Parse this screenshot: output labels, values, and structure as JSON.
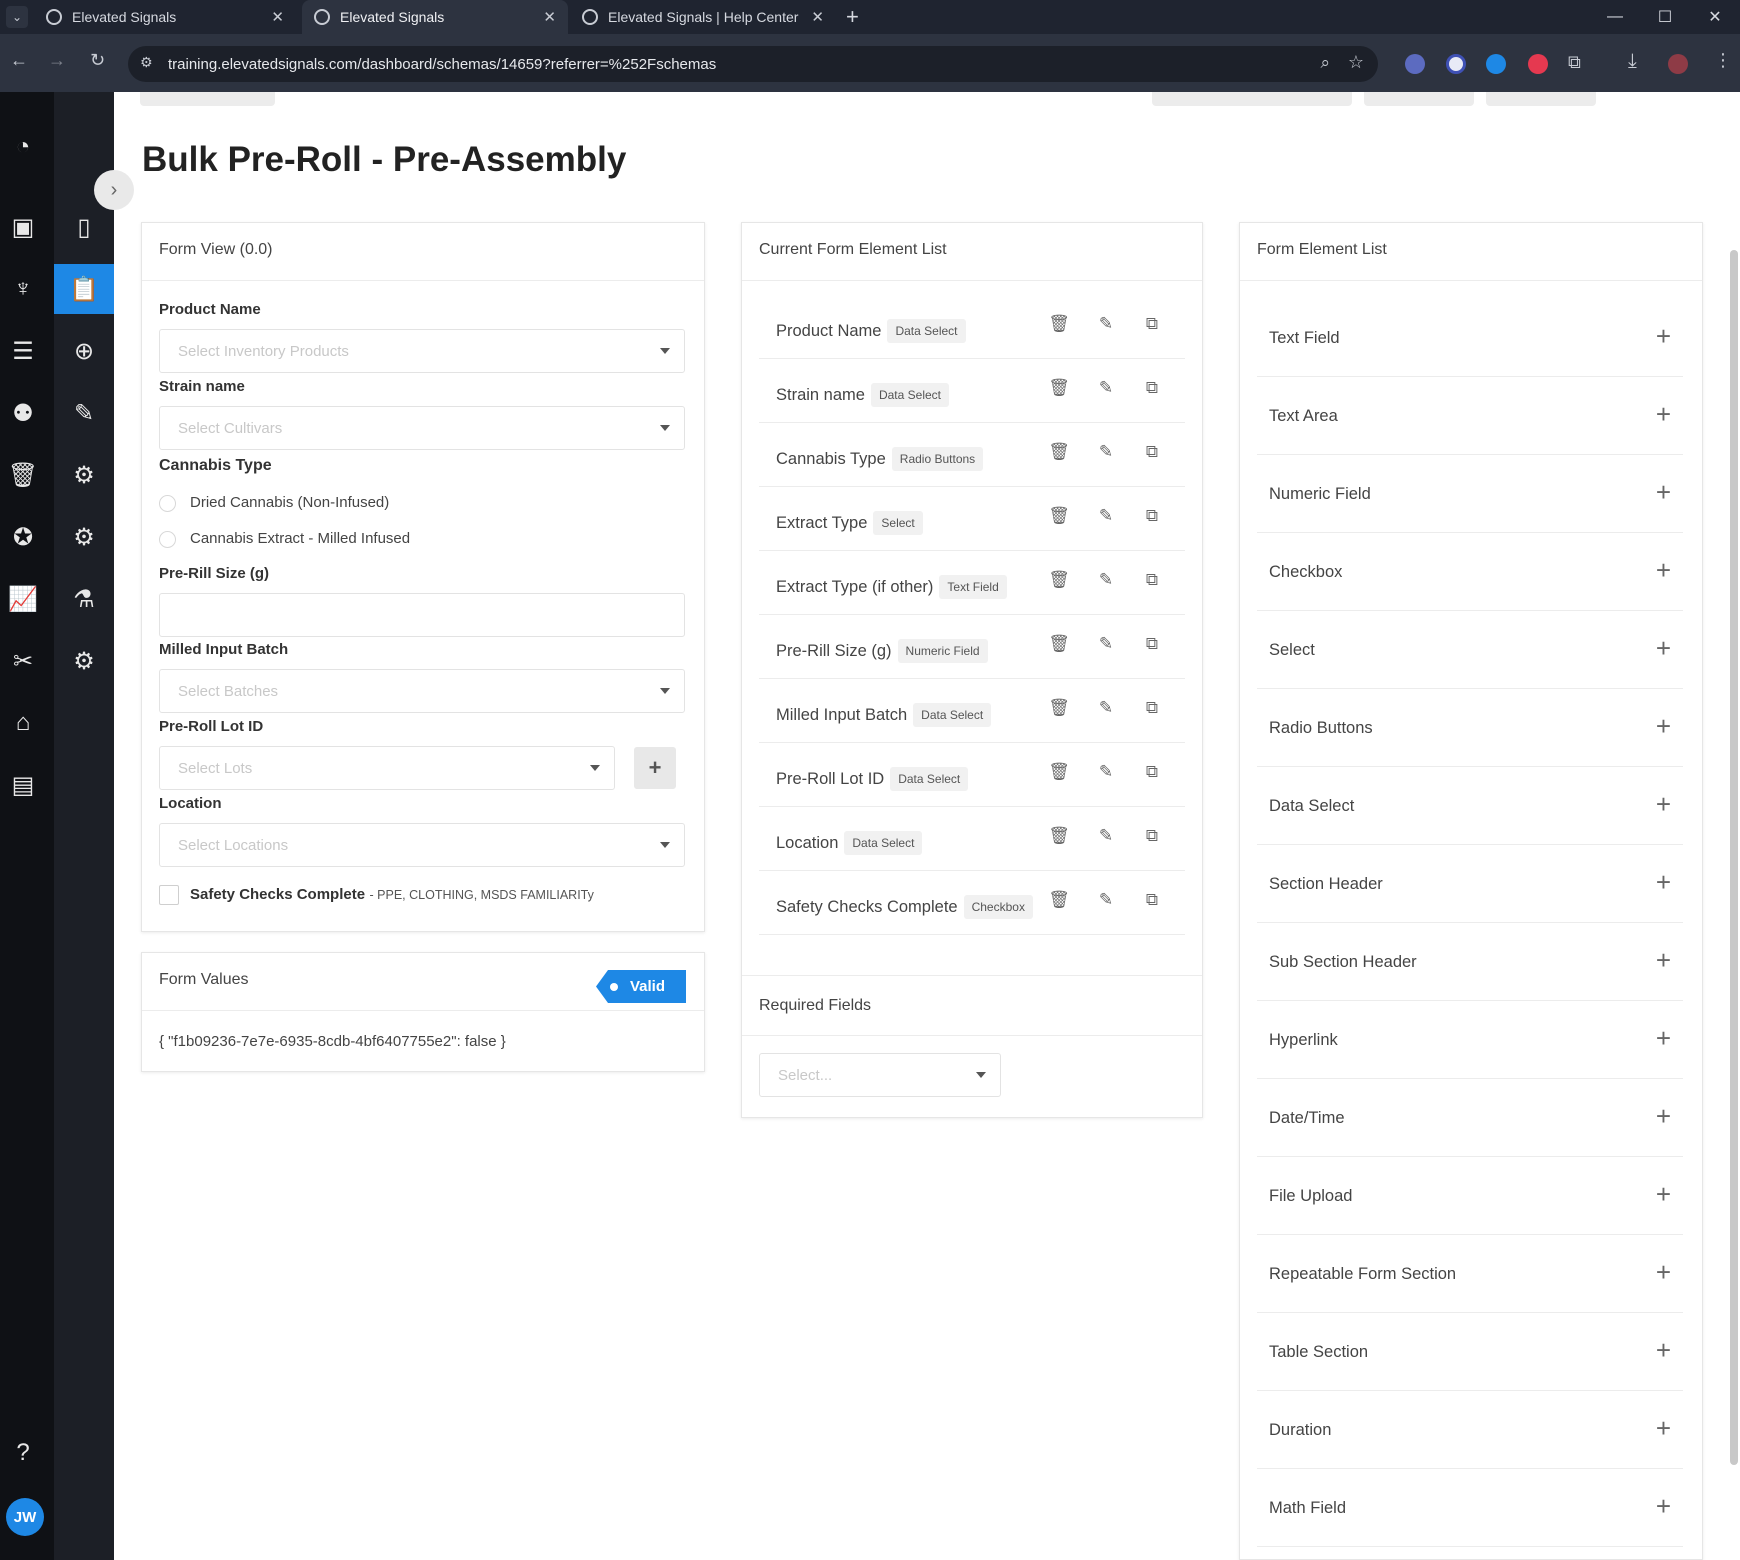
{
  "browser": {
    "tabs": [
      {
        "title": "Elevated Signals",
        "active": false
      },
      {
        "title": "Elevated Signals",
        "active": true
      },
      {
        "title": "Elevated Signals | Help Center",
        "active": false
      }
    ],
    "url": "training.elevatedsignals.com/dashboard/schemas/14659?referrer=%252Fschemas"
  },
  "user": {
    "initials": "JW"
  },
  "page": {
    "title": "Bulk Pre-Roll - Pre-Assembly"
  },
  "form_view": {
    "title": "Form View (0.0)",
    "product_name": {
      "label": "Product Name",
      "placeholder": "Select Inventory Products"
    },
    "strain_name": {
      "label": "Strain name",
      "placeholder": "Select Cultivars"
    },
    "cannabis_type": {
      "label": "Cannabis Type",
      "options": [
        "Dried Cannabis (Non-Infused)",
        "Cannabis Extract - Milled Infused"
      ]
    },
    "pre_rill_size": {
      "label": "Pre-Rill Size (g)",
      "value": ""
    },
    "milled_input_batch": {
      "label": "Milled Input Batch",
      "placeholder": "Select Batches"
    },
    "pre_roll_lot_id": {
      "label": "Pre-Roll Lot ID",
      "placeholder": "Select Lots"
    },
    "location": {
      "label": "Location",
      "placeholder": "Select Locations"
    },
    "safety": {
      "label": "Safety Checks Complete",
      "note": "- PPE, CLOTHING, MSDS FAMILIARITy",
      "checked": false
    }
  },
  "form_values": {
    "title": "Form Values",
    "status": "Valid",
    "json": "{ \"f1b09236-7e7e-6935-8cdb-4bf6407755e2\": false }"
  },
  "current_list": {
    "title": "Current Form Element List",
    "items": [
      {
        "name": "Product Name",
        "type": "Data Select"
      },
      {
        "name": "Strain name",
        "type": "Data Select"
      },
      {
        "name": "Cannabis Type",
        "type": "Radio Buttons"
      },
      {
        "name": "Extract Type",
        "type": "Select"
      },
      {
        "name": "Extract Type (if other)",
        "type": "Text Field"
      },
      {
        "name": "Pre-Rill Size (g)",
        "type": "Numeric Field"
      },
      {
        "name": "Milled Input Batch",
        "type": "Data Select"
      },
      {
        "name": "Pre-Roll Lot ID",
        "type": "Data Select"
      },
      {
        "name": "Location",
        "type": "Data Select"
      },
      {
        "name": "Safety Checks Complete",
        "type": "Checkbox"
      }
    ],
    "required_fields": {
      "title": "Required Fields",
      "placeholder": "Select..."
    }
  },
  "element_list": {
    "title": "Form Element List",
    "items": [
      "Text Field",
      "Text Area",
      "Numeric Field",
      "Checkbox",
      "Select",
      "Radio Buttons",
      "Data Select",
      "Section Header",
      "Sub Section Header",
      "Hyperlink",
      "Date/Time",
      "File Upload",
      "Repeatable Form Section",
      "Table Section",
      "Duration",
      "Math Field"
    ]
  },
  "colors": {
    "accent": "#1e88e5",
    "rail": "#0f1115",
    "rail2": "#1c1f26"
  }
}
